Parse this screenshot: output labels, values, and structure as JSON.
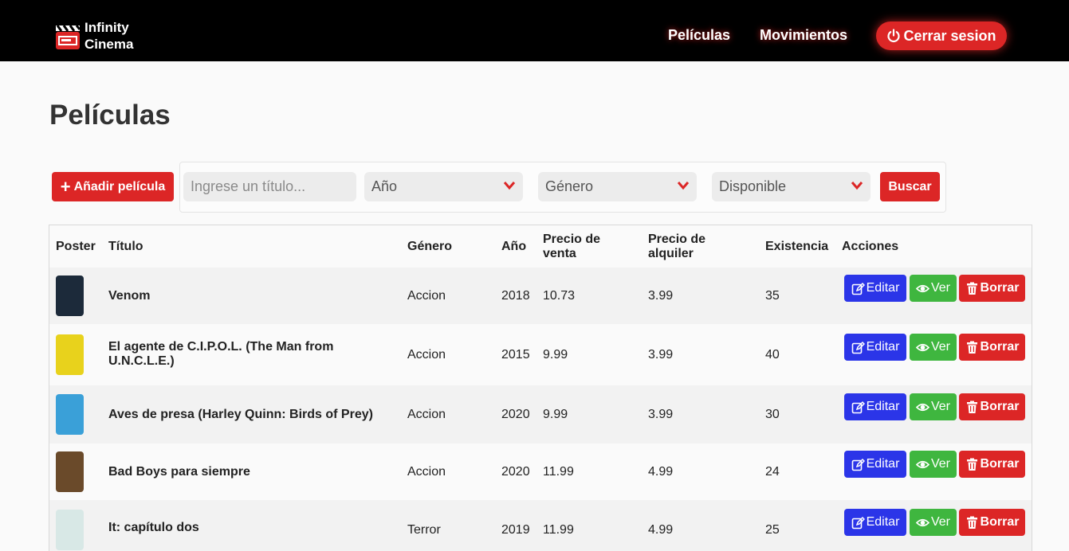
{
  "nav": {
    "brand_line1": "Infinity",
    "brand_line2": "Cinema",
    "links": [
      "Películas",
      "Movimientos"
    ],
    "logout": "Cerrar sesion"
  },
  "page": {
    "title": "Películas"
  },
  "filters": {
    "add_label": "Añadir película",
    "title_placeholder": "Ingrese un título...",
    "year_label": "Año",
    "genre_label": "Género",
    "available_label": "Disponible",
    "search_label": "Buscar"
  },
  "table": {
    "headers": {
      "poster": "Poster",
      "title": "Título",
      "genre": "Género",
      "year": "Año",
      "sale_price_1": "Precio de",
      "sale_price_2": "venta",
      "rent_price_1": "Precio de",
      "rent_price_2": "alquiler",
      "stock": "Existencia",
      "actions": "Acciones"
    },
    "action_labels": {
      "edit": "Editar",
      "view": "Ver",
      "delete": "Borrar"
    },
    "rows": [
      {
        "title": "Venom",
        "genre": "Accion",
        "year": "2018",
        "sale": "10.73",
        "rent": "3.99",
        "stock": "35",
        "poster_color": "#1c2a3a"
      },
      {
        "title": "El agente de C.I.P.O.L. (The Man from U.N.C.L.E.)",
        "genre": "Accion",
        "year": "2015",
        "sale": "9.99",
        "rent": "3.99",
        "stock": "40",
        "poster_color": "#e8d21c"
      },
      {
        "title": "Aves de presa (Harley Quinn: Birds of Prey)",
        "genre": "Accion",
        "year": "2020",
        "sale": "9.99",
        "rent": "3.99",
        "stock": "30",
        "poster_color": "#3aa0d8"
      },
      {
        "title": "Bad Boys para siempre",
        "genre": "Accion",
        "year": "2020",
        "sale": "11.99",
        "rent": "4.99",
        "stock": "24",
        "poster_color": "#6a4a2a"
      },
      {
        "title": "It: capítulo dos",
        "genre": "Terror",
        "year": "2019",
        "sale": "11.99",
        "rent": "4.99",
        "stock": "25",
        "poster_color": "#d8e8e6"
      }
    ]
  },
  "colors": {
    "accent": "#dc2626",
    "edit": "#2b35e8",
    "view": "#3fb63f"
  }
}
